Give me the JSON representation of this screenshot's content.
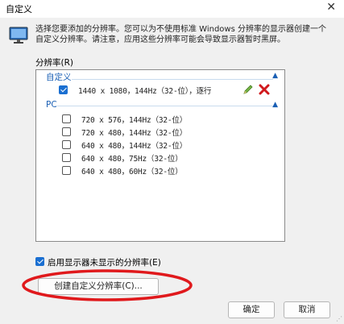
{
  "window": {
    "title": "自定义",
    "close_glyph": "✕"
  },
  "description": "选择您要添加的分辨率。您可以为不使用标准 Windows 分辨率的显示器创建一个自定义分辨率。请注意，应用这些分辨率可能会导致显示器暂时黑屏。",
  "resolution_list": {
    "label": "分辨率(R)",
    "groups": [
      {
        "header": "自定义",
        "items": [
          {
            "text": "1440 x 1080，144Hz（32-位），逐行",
            "checked": true
          }
        ]
      },
      {
        "header": "PC",
        "items": [
          {
            "text": "720 x 576，144Hz（32-位）",
            "checked": false
          },
          {
            "text": "720 x 480，144Hz（32-位）",
            "checked": false
          },
          {
            "text": "640 x 480，144Hz（32-位）",
            "checked": false
          },
          {
            "text": "640 x 480，75Hz（32-位）",
            "checked": false
          },
          {
            "text": "640 x 480，60Hz（32-位）",
            "checked": false
          }
        ]
      }
    ]
  },
  "enable_hidden": {
    "label": "启用显示器未显示的分辨率(E)",
    "checked": true
  },
  "buttons": {
    "create": "创建自定义分辨率(C)...",
    "ok": "确定",
    "cancel": "取消"
  },
  "icons": {
    "window_icon": "monitor-icon",
    "edit": "pencil-icon",
    "delete": "delete-x-icon",
    "collapse": "chevron-up-icon"
  },
  "colors": {
    "accent": "#1a6fd1",
    "group_header": "#1a5fb4",
    "delete_red": "#d0191d",
    "annotation": "#e0191c"
  }
}
